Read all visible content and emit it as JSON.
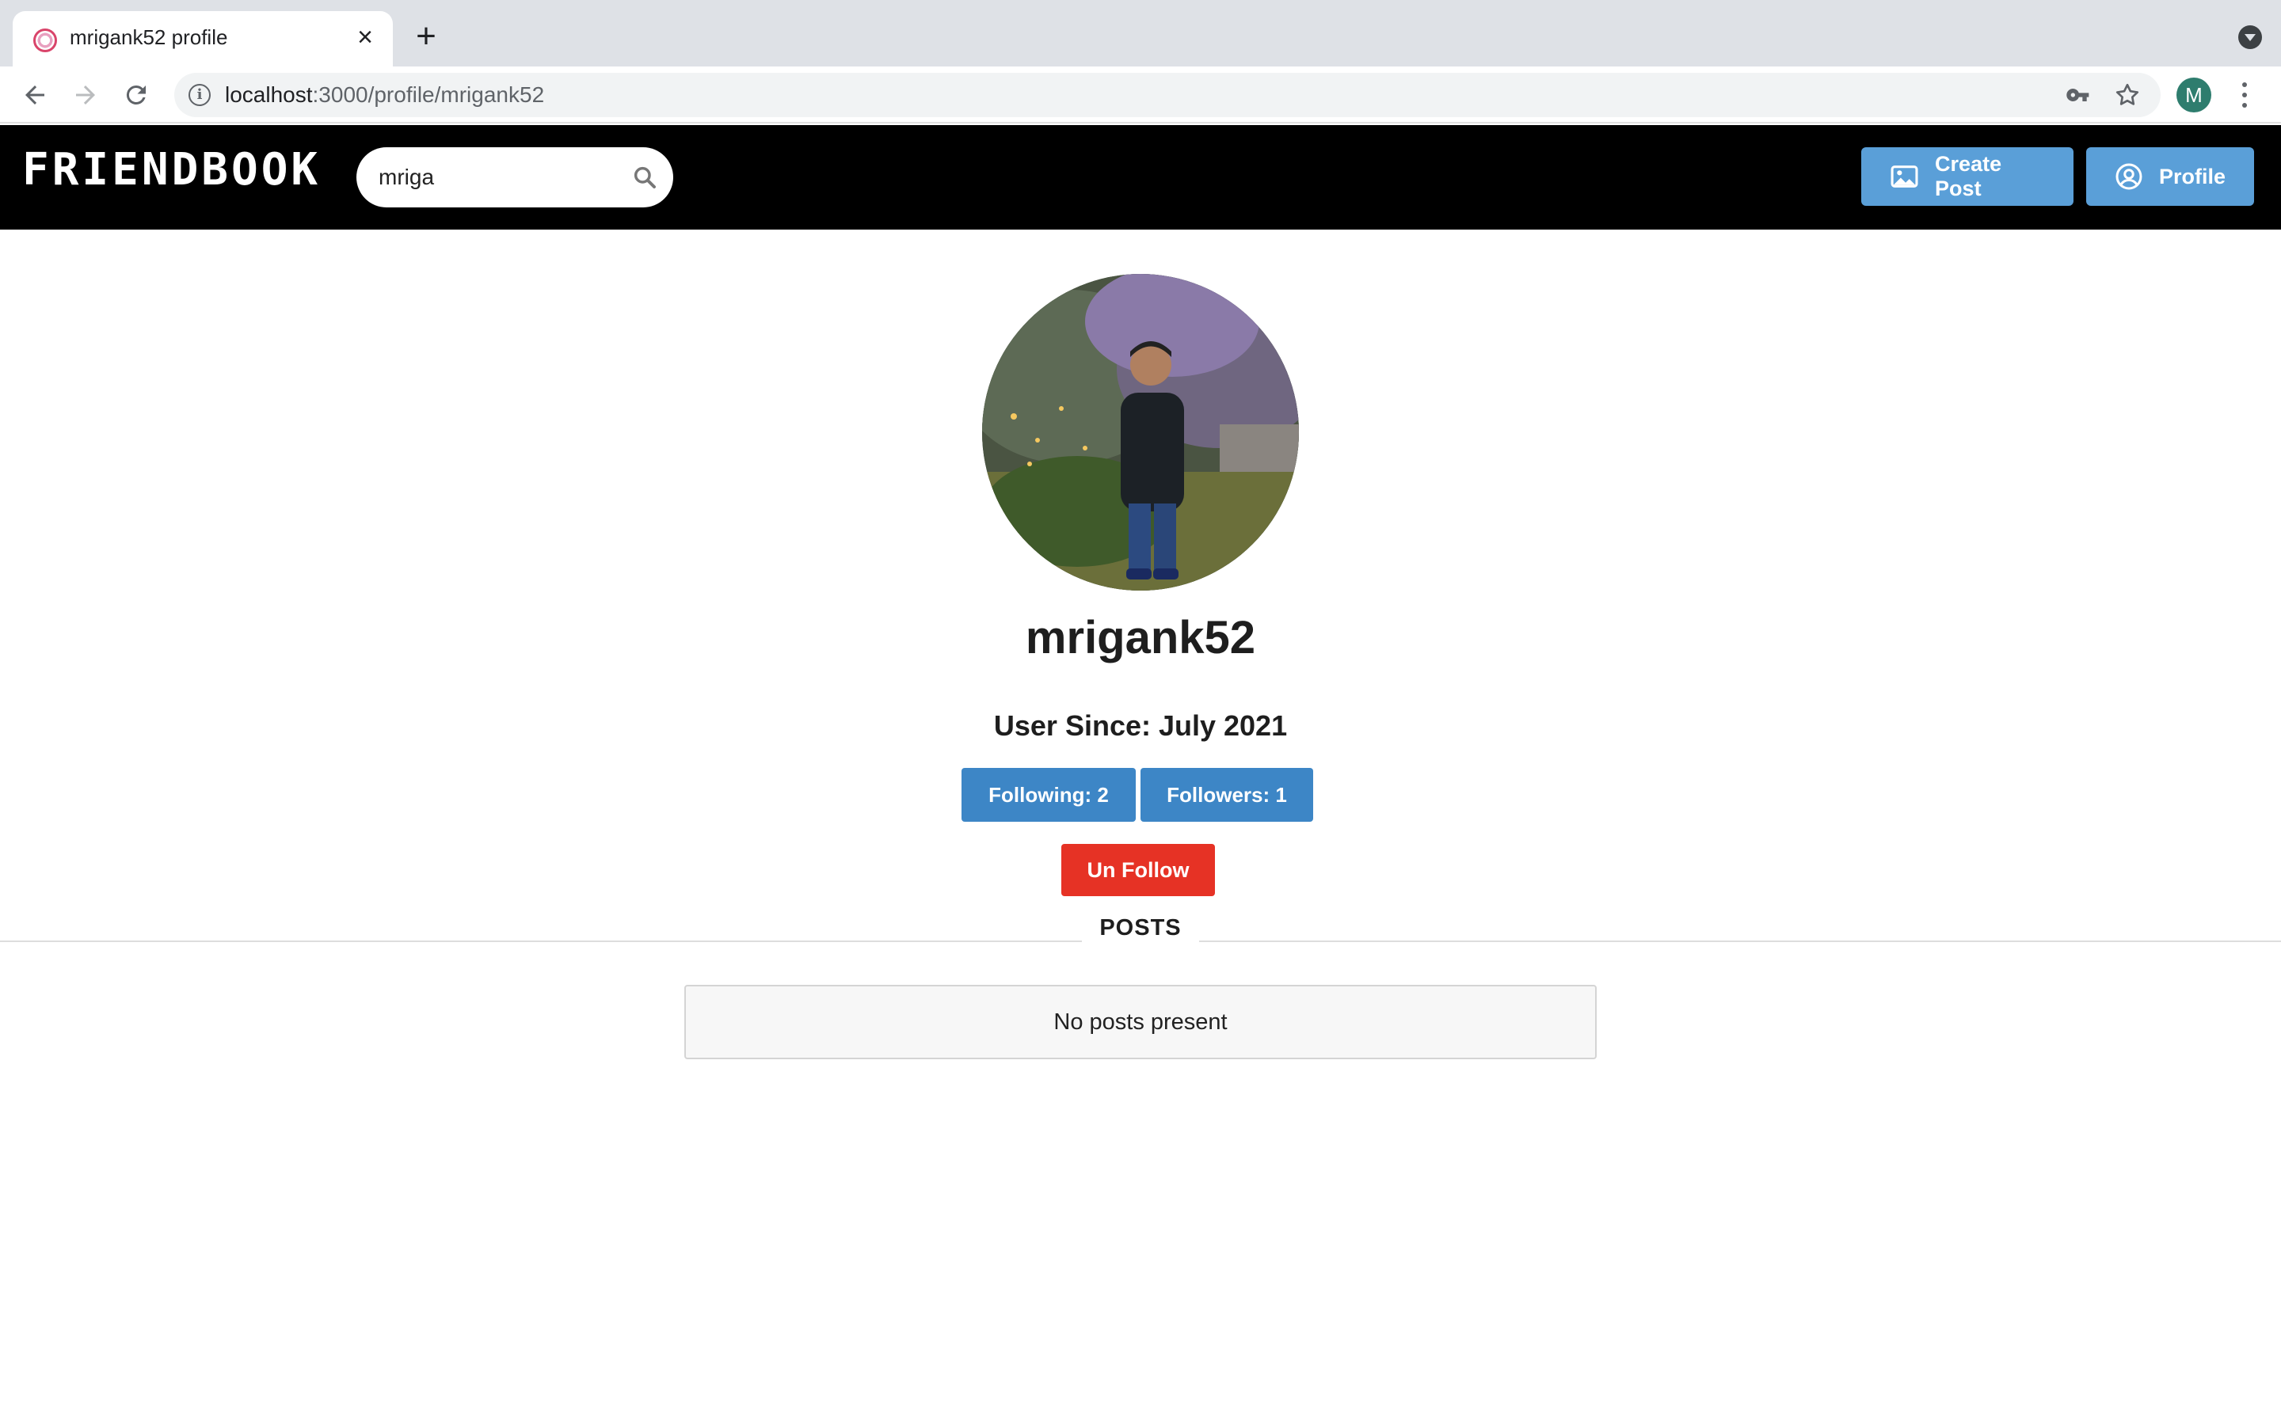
{
  "browser": {
    "tab_title": "mrigank52 profile",
    "url_host": "localhost",
    "url_path": ":3000/profile/mrigank52",
    "account_initial": "M"
  },
  "header": {
    "brand": "FRIENDBOOK",
    "search_value": "mriga",
    "create_post_label": "Create Post",
    "profile_label": "Profile"
  },
  "profile": {
    "username": "mrigank52",
    "user_since": "User Since: July 2021",
    "following_label": "Following: 2",
    "followers_label": "Followers: 1",
    "unfollow_label": "Un Follow"
  },
  "posts": {
    "section_label": "POSTS",
    "empty_message": "No posts present"
  },
  "colors": {
    "header_bg": "#000000",
    "header_button": "#5a9fd8",
    "stat_button": "#3d86c6",
    "unfollow_button": "#e63225"
  },
  "icons": {
    "search": "search-icon",
    "create_post": "image-icon",
    "profile": "user-circle-icon"
  }
}
